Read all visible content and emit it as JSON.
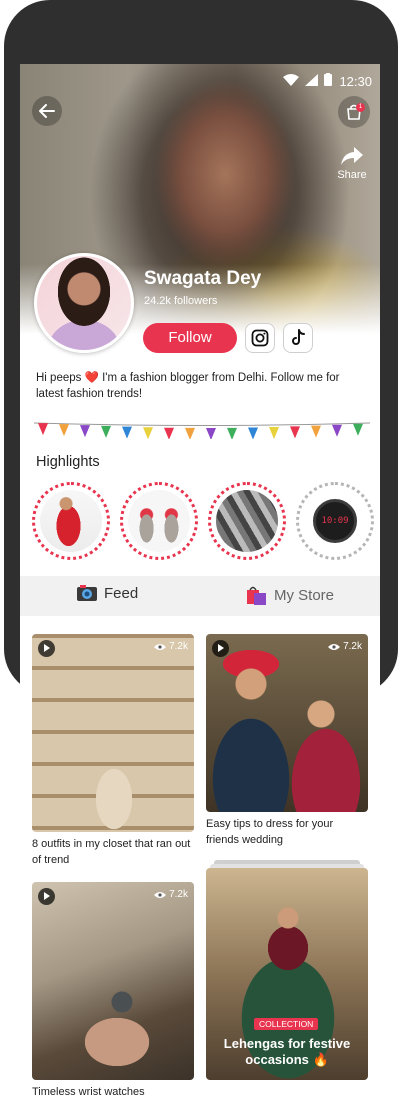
{
  "status_bar": {
    "time": "12:30"
  },
  "header": {
    "share_label": "Share",
    "cart_badge_count": "1"
  },
  "profile": {
    "name": "Swagata Dey",
    "followers": "24.2k followers",
    "follow_label": "Follow",
    "bio": "Hi peeps ❤️ I'm a fashion blogger from Delhi. Follow me for latest fashion trends!"
  },
  "highlights": {
    "title": "Highlights",
    "items": [
      {
        "icon": "red-dress-photo"
      },
      {
        "icon": "earrings-photo"
      },
      {
        "icon": "phone-case-photo"
      },
      {
        "icon": "smartwatch-photo",
        "watch_time": "10:09"
      }
    ]
  },
  "tabs": [
    {
      "label": "Feed",
      "icon": "camera-icon"
    },
    {
      "label": "My Store",
      "icon": "shopping-bags-icon"
    }
  ],
  "feed": [
    {
      "caption": "8 outfits in my closet that ran out of trend",
      "views": "7.2k"
    },
    {
      "caption": "Easy tips to dress for your friends wedding",
      "views": "7.2k"
    },
    {
      "caption": "Timeless wrist watches",
      "views": "7.2k"
    },
    {
      "tag": "COLLECTION",
      "title": "Lehengas for festive occasions 🔥"
    }
  ],
  "colors": {
    "accent": "#e8344e",
    "device_frame": "#2f2f2f",
    "tab_bg": "#f1f1f1"
  }
}
